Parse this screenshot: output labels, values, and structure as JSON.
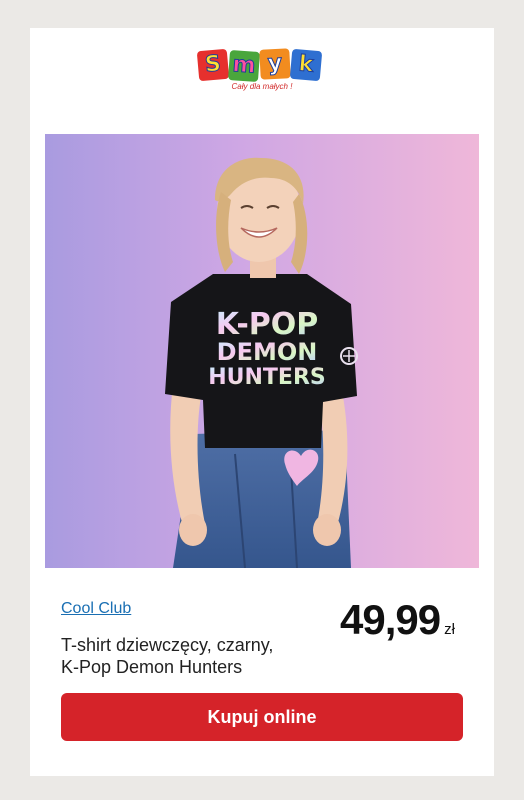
{
  "logo": {
    "letters": [
      "S",
      "m",
      "y",
      "k"
    ],
    "tagline": "Cały dla małych !",
    "tile_colors": [
      "#e6302d",
      "#4aa63c",
      "#f28c1f",
      "#2e6fd1"
    ]
  },
  "product": {
    "image_alt_icon": "product-photo",
    "shirt_print_lines": [
      "K-POP",
      "DEMON",
      "HUNTERS"
    ],
    "brand": "Cool Club",
    "title_lines": [
      "T-shirt dziewczęcy, czarny,",
      "K-Pop Demon Hunters"
    ],
    "price": "49,99",
    "currency": "zł"
  },
  "actions": {
    "buy_label": "Kupuj online"
  },
  "colors": {
    "page_background": "#ebe9e6",
    "card_background": "#ffffff",
    "button_red": "#d52329",
    "link_blue": "#1a6fb3"
  }
}
